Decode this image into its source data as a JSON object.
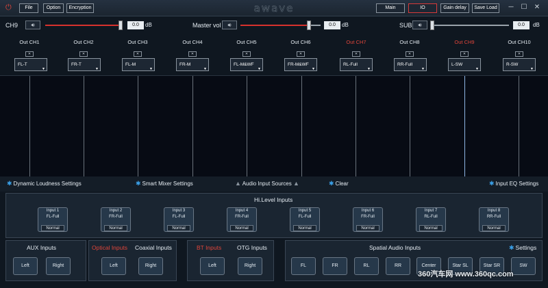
{
  "topbar": {
    "buttons": [
      "File",
      "Option",
      "Encryption"
    ],
    "logo": "awave",
    "right_buttons": [
      "Main",
      "IO",
      "Gain delay",
      "Save Load"
    ],
    "active_button": "IO",
    "window_controls": [
      "minimize",
      "maximize",
      "close"
    ]
  },
  "volume": {
    "ch9": {
      "label": "CH9",
      "value": "0.0",
      "unit": "dB",
      "level": 0.88
    },
    "master": {
      "label": "Master vol",
      "value": "0.0",
      "unit": "dB",
      "level": 0.85
    },
    "sub": {
      "label": "SUB",
      "value": "0.0",
      "unit": "dB",
      "level": 0.02
    }
  },
  "channels": [
    {
      "label": "Out CH1",
      "assign": "FL-T",
      "highlight": false
    },
    {
      "label": "Out CH2",
      "assign": "FR-T",
      "highlight": false
    },
    {
      "label": "Out CH3",
      "assign": "FL-M",
      "highlight": false
    },
    {
      "label": "Out CH4",
      "assign": "FR-M",
      "highlight": false
    },
    {
      "label": "Out CH5",
      "assign": "FL-M&WF",
      "highlight": false
    },
    {
      "label": "Out CH6",
      "assign": "FR-M&WF",
      "highlight": false
    },
    {
      "label": "Out CH7",
      "assign": "RL-Full",
      "highlight": true
    },
    {
      "label": "Out CH8",
      "assign": "RR-Full",
      "highlight": false
    },
    {
      "label": "Out CH9",
      "assign": "L-SW",
      "highlight": true
    },
    {
      "label": "Out CH10",
      "assign": "R-SW",
      "highlight": false
    }
  ],
  "toolbar": {
    "dynamic_loudness": "Dynamic Loudness Settings",
    "smart_mixer": "Smart Mixer Settings",
    "audio_input_sources": "Audio Input Sources",
    "clear": "Clear",
    "input_eq": "Input EQ Settings"
  },
  "hilevel": {
    "title": "Hi.Level Inputs",
    "inputs": [
      {
        "name": "Input 1",
        "src": "FL-Full",
        "mode": "Normal"
      },
      {
        "name": "Input 2",
        "src": "FR-Full",
        "mode": "Normal"
      },
      {
        "name": "Input 3",
        "src": "FL-Full",
        "mode": "Normal"
      },
      {
        "name": "Input 4",
        "src": "FR-Full",
        "mode": "Normal"
      },
      {
        "name": "Input 5",
        "src": "FL-Full",
        "mode": "Normal"
      },
      {
        "name": "Input 6",
        "src": "FR-Full",
        "mode": "Normal"
      },
      {
        "name": "Input 7",
        "src": "RL-Full",
        "mode": "Normal"
      },
      {
        "name": "Input 8",
        "src": "RR-Full",
        "mode": "Normal"
      }
    ]
  },
  "aux": {
    "title": "AUX Inputs",
    "left": "Left",
    "right": "Right"
  },
  "coaxial": {
    "optical": "Optical Inputs",
    "title": "Coaxial Inputs",
    "left": "Left",
    "right": "Right"
  },
  "otg": {
    "bt": "BT Inputs",
    "title": "OTG Inputs",
    "left": "Left",
    "right": "Right"
  },
  "spatial": {
    "title": "Spatial Audio Inputs",
    "settings": "Settings",
    "buttons": [
      "FL",
      "FR",
      "RL",
      "RR",
      "Center",
      "Star SL",
      "Star SR",
      "SW"
    ]
  },
  "watermark": "360汽车网 www.360qc.com",
  "colors": {
    "accent_red": "#d8322d",
    "accent_blue": "#3aa0e8",
    "bg": "#0f1720"
  }
}
